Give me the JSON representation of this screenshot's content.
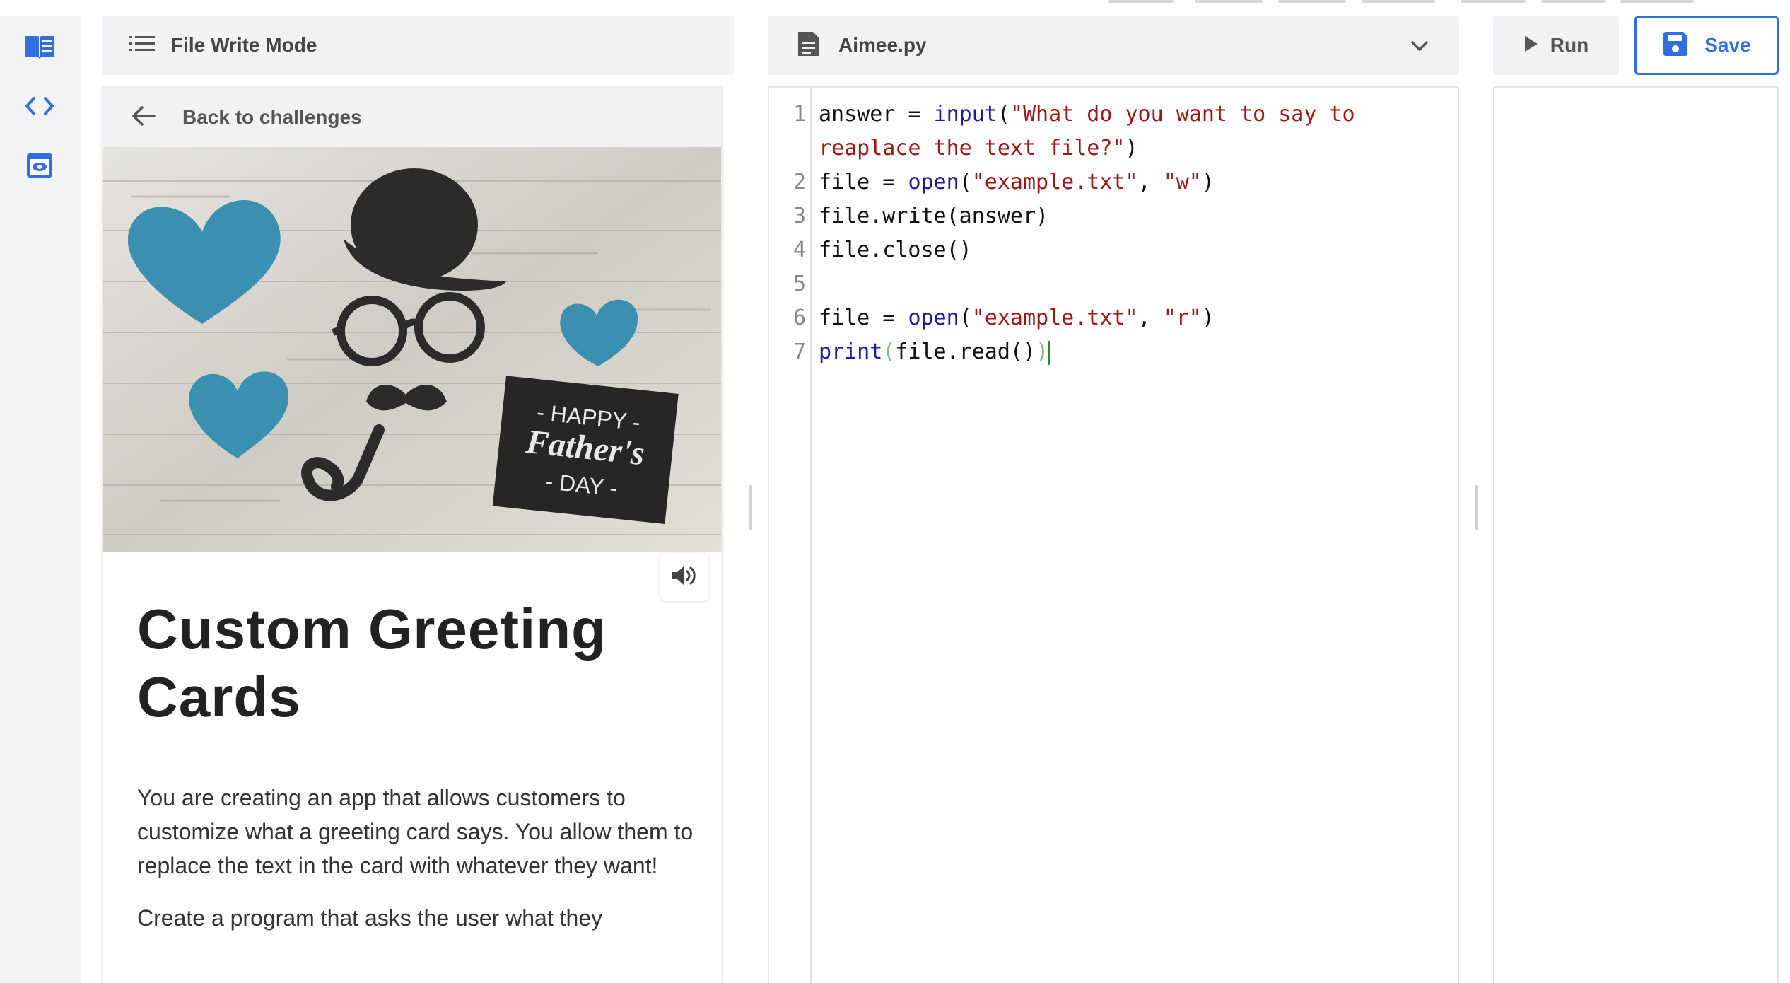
{
  "rail": {
    "icons": [
      "book-icon",
      "code-icon",
      "preview-icon"
    ]
  },
  "lesson": {
    "header_label": "File Write Mode",
    "back_label": "Back to challenges",
    "image": {
      "card_line1": "- HAPPY -",
      "card_line2": "Father's",
      "card_line3": "- DAY -"
    },
    "title": "Custom Greeting Cards",
    "paragraphs": [
      "You are creating an app that allows customers to customize what a greeting card says. You allow them to replace the text in the card with whatever they want!",
      "Create a program that asks the user what they"
    ]
  },
  "editor": {
    "filename": "Aimee.py",
    "lines": [
      {
        "n": "1",
        "html": "answer = <span class=\"tok-kw\">input</span>(<span class=\"tok-str\">\"What do you want to say to</span>"
      },
      {
        "n": "",
        "html": "<span class=\"tok-str\">reaplace the text file?\"</span>)"
      },
      {
        "n": "2",
        "html": "file = <span class=\"tok-kw\">open</span>(<span class=\"tok-str\">\"example.txt\"</span>, <span class=\"tok-str\">\"w\"</span>)"
      },
      {
        "n": "3",
        "html": "file.write(answer)"
      },
      {
        "n": "4",
        "html": "file.close()"
      },
      {
        "n": "5",
        "html": ""
      },
      {
        "n": "6",
        "html": "file = <span class=\"tok-kw\">open</span>(<span class=\"tok-str\">\"example.txt\"</span>, <span class=\"tok-str\">\"r\"</span>)"
      },
      {
        "n": "7",
        "html": "<span class=\"tok-kw\">print</span><span class=\"tok-dim\">(</span>file.read()<span class=\"tok-dim\">)</span><span class=\"cursor\"></span>"
      }
    ]
  },
  "toolbar": {
    "run_label": "Run",
    "save_label": "Save"
  },
  "colors": {
    "accent": "#2f6fdf",
    "heart": "#3b8fb0",
    "keyword": "#1a1aa6",
    "string": "#a31515"
  }
}
